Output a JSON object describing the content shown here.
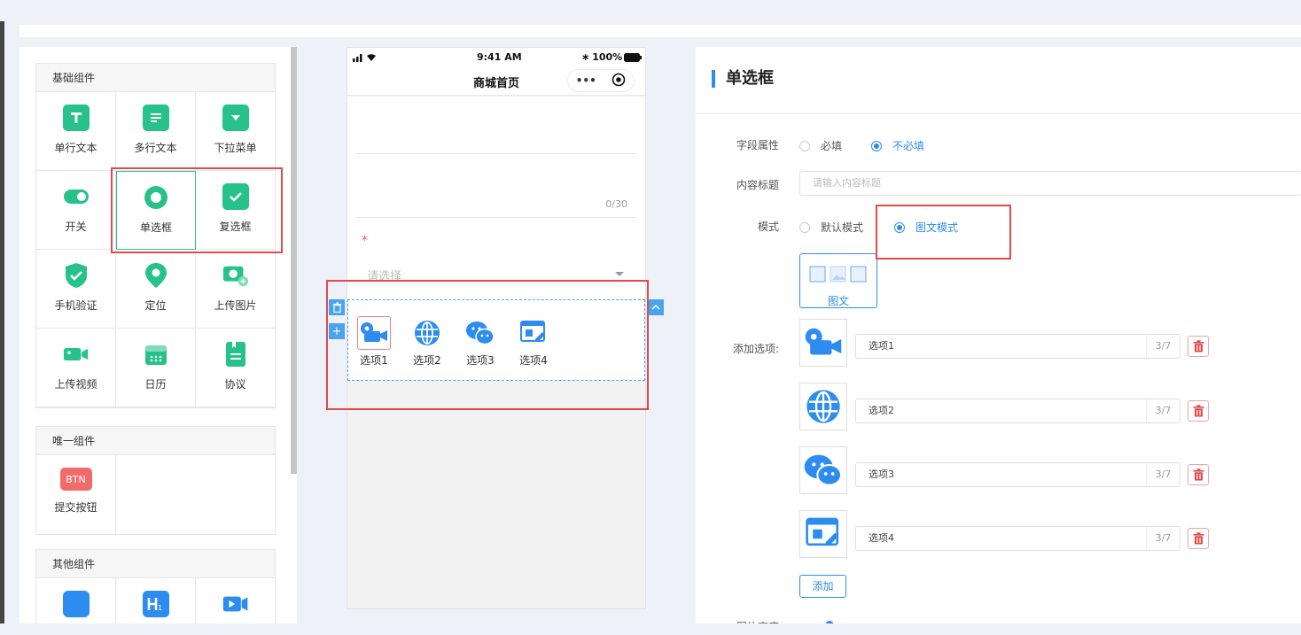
{
  "palette": {
    "basic_title": "基础组件",
    "basic_items": [
      "单行文本",
      "多行文本",
      "下拉菜单",
      "开关",
      "单选框",
      "复选框",
      "手机验证",
      "定位",
      "上传图片",
      "上传视频",
      "日历",
      "协议"
    ],
    "unique_title": "唯一组件",
    "unique_items": [
      "提交按钮"
    ],
    "btn_icon_text": "BTN",
    "other_title": "其他组件"
  },
  "phone": {
    "time": "9:41 AM",
    "battery": "100%",
    "page_title": "商城首页",
    "capsule_more": "•••",
    "counter": "0/30",
    "required_mark": "*",
    "select_placeholder": "请选择",
    "options": [
      "选项1",
      "选项2",
      "选项3",
      "选项4"
    ]
  },
  "panel": {
    "title": "单选框",
    "field_attr_label": "字段属性",
    "required": "必填",
    "not_required": "不必填",
    "content_title_label": "内容标题",
    "content_title_placeholder": "请输入内容标题",
    "mode_label": "模式",
    "mode_default": "默认模式",
    "mode_image_text": "图文模式",
    "mode_card_label": "图文",
    "add_options_label": "添加选项:",
    "options": [
      {
        "value": "选项1",
        "count": "3/7"
      },
      {
        "value": "选项2",
        "count": "3/7"
      },
      {
        "value": "选项3",
        "count": "3/7"
      },
      {
        "value": "选项4",
        "count": "3/7"
      }
    ],
    "add_button": "添加",
    "image_height_label": "图片高度"
  },
  "colors": {
    "green": "#27c289",
    "blue": "#2d8cf0",
    "red": "#e24a4a"
  }
}
